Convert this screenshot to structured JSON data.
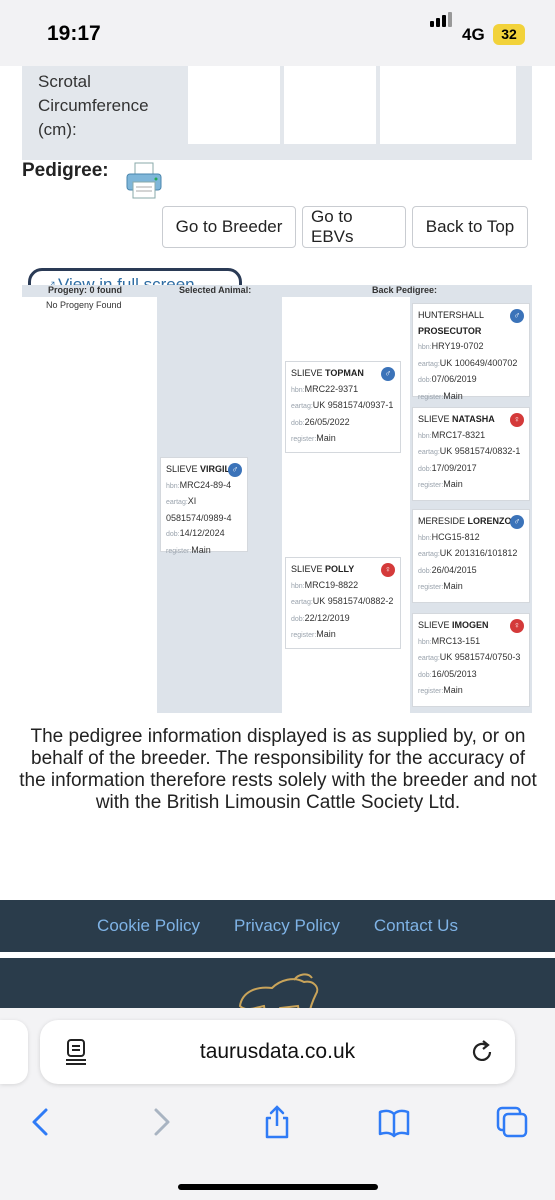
{
  "status_bar": {
    "time": "19:17",
    "network": "4G",
    "battery": "32"
  },
  "scrotal": {
    "label": "Scrotal Circumference (cm):"
  },
  "pedigree": {
    "heading": "Pedigree:"
  },
  "buttons": {
    "breeder": "Go to Breeder",
    "ebvs": "Go to EBVs",
    "top": "Back to Top"
  },
  "fullscreen": {
    "label": "View in full screen"
  },
  "board": {
    "progeny_header": "Progeny: 0 found",
    "selected_header": "Selected Animal:",
    "back_header": "Back Pedigree:",
    "progeny_none": "No Progeny Found",
    "keys": {
      "hbn": "hbn:",
      "eartag": "eartag:",
      "dob": "dob:",
      "register": "register:"
    },
    "selected": {
      "prefix": "SLIEVE",
      "name": "VIRGIL",
      "sex": "male",
      "hbn": "MRC24-89-4",
      "eartag": "XI 0581574/0989-4",
      "dob": "14/12/2024",
      "register": "Main"
    },
    "sire": {
      "prefix": "SLIEVE",
      "name": "TOPMAN",
      "sex": "male",
      "hbn": "MRC22-9371",
      "eartag": "UK 9581574/0937-1",
      "dob": "26/05/2022",
      "register": "Main"
    },
    "dam": {
      "prefix": "SLIEVE",
      "name": "POLLY",
      "sex": "female",
      "hbn": "MRC19-8822",
      "eartag": "UK 9581574/0882-2",
      "dob": "22/12/2019",
      "register": "Main"
    },
    "ss": {
      "prefix": "HUNTERSHALL",
      "name": "PROSECUTOR",
      "sex": "male",
      "hbn": "HRY19-0702",
      "eartag": "UK 100649/400702",
      "dob": "07/06/2019",
      "register": "Main"
    },
    "sd": {
      "prefix": "SLIEVE",
      "name": "NATASHA",
      "sex": "female",
      "hbn": "MRC17-8321",
      "eartag": "UK 9581574/0832-1",
      "dob": "17/09/2017",
      "register": "Main"
    },
    "ds": {
      "prefix": "MERESIDE",
      "name": "LORENZO",
      "sex": "male",
      "hbn": "HCG15-812",
      "eartag": "UK 201316/101812",
      "dob": "26/04/2015",
      "register": "Main"
    },
    "dd": {
      "prefix": "SLIEVE",
      "name": "IMOGEN",
      "sex": "female",
      "hbn": "MRC13-151",
      "eartag": "UK 9581574/0750-3",
      "dob": "16/05/2013",
      "register": "Main"
    }
  },
  "disclaimer": "The pedigree information displayed is as supplied by, or on behalf of the breeder. The responsibility for the accuracy of the information therefore rests solely with the breeder and not with the British Limousin Cattle Society Ltd.",
  "footer": {
    "cookie": "Cookie Policy",
    "privacy": "Privacy Policy",
    "contact": "Contact Us"
  },
  "browser": {
    "url": "taurusdata.co.uk"
  },
  "icons": {
    "printer": "printer-icon",
    "expand": "expand-icon",
    "reader": "reader-mode-icon",
    "reload": "reload-icon",
    "back": "back-icon",
    "forward": "forward-icon",
    "share": "share-icon",
    "bookmarks": "bookmarks-icon",
    "tabs": "tabs-icon"
  },
  "colors": {
    "footer_bg": "#2a3c4b",
    "link": "#7fb3e6",
    "male": "#3b73b9",
    "female": "#d43a3a",
    "panel": "#dde3ea"
  }
}
